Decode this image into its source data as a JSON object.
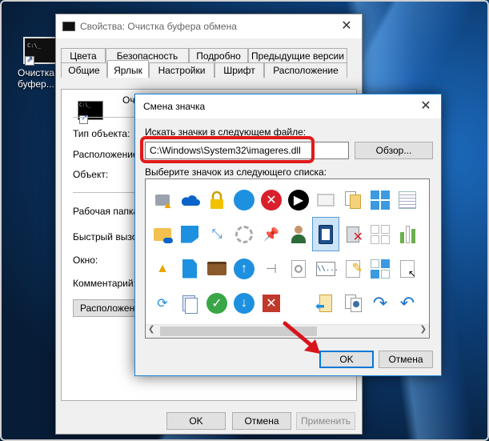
{
  "desktop": {
    "icon_label_line1": "Очистка",
    "icon_label_line2": "буфер...",
    "icon_name": "command-prompt-shortcut-icon",
    "cmd_text": "C:\\_"
  },
  "props": {
    "title": "Свойства: Очистка буфера обмена",
    "tabs_row1": [
      "Цвета",
      "Безопасность",
      "Подробно",
      "Предыдущие версии"
    ],
    "tabs_row2": [
      "Общие",
      "Ярлык",
      "Настройки",
      "Шрифт",
      "Расположение"
    ],
    "active_tab": "Ярлык",
    "shortcut_name": "Очи",
    "fields": {
      "target_type": "Тип объекта:",
      "location": "Расположение:",
      "target": "Объект:",
      "start_in": "Рабочая папка:",
      "shortcut_key": "Быстрый вызов",
      "run": "Окно:",
      "comment": "Комментарий:"
    },
    "open_location_button": "Расположение",
    "buttons": {
      "ok": "OK",
      "cancel": "Отмена",
      "apply": "Применить"
    }
  },
  "dialog": {
    "title": "Смена значка",
    "search_label": "Искать значки в следующем файле:",
    "path_value": "C:\\Windows\\System32\\imageres.dll",
    "browse_button": "Обзор...",
    "select_label": "Выберите значок из следующего списка:",
    "ok_button": "OK",
    "cancel_button": "Отмена",
    "selected_icon": "clipboard-shortcut-icon",
    "icons": [
      "shield-disk-warning-icon",
      "onedrive-cloud-icon",
      "lock-icon",
      "blue-circle-icon",
      "red-x-circle-icon",
      "play-circle-icon",
      "screen-shortcut-icon",
      "documents-icon",
      "windows-tiles-icon",
      "list-view-icon",
      "folder-onedrive-warning-icon",
      "blue-folder-icon",
      "shrink-arrows-icon",
      "dashed-circle-icon",
      "pin-icon",
      "user-account-icon",
      "clipboard-shortcut-icon",
      "recycle-x-icon",
      "grid-icon",
      "bar-chart-icon",
      "warning-icon",
      "blue-document-icon",
      "briefcase-icon",
      "up-arrow-circle-icon",
      "pin-horizontal-icon",
      "disc-page-icon",
      "network-path-icon",
      "pencil-page-icon",
      "tiles-icon",
      "cursor-page-icon",
      "sync-icon",
      "document-stack-icon",
      "green-check-icon",
      "down-arrow-circle-icon",
      "red-x-square-icon",
      "",
      "folder-arrow-icon",
      "people-icon",
      "redo-icon",
      "undo-icon"
    ]
  },
  "colors": {
    "accent": "#0078d7",
    "highlight_red": "#e21a1a"
  }
}
